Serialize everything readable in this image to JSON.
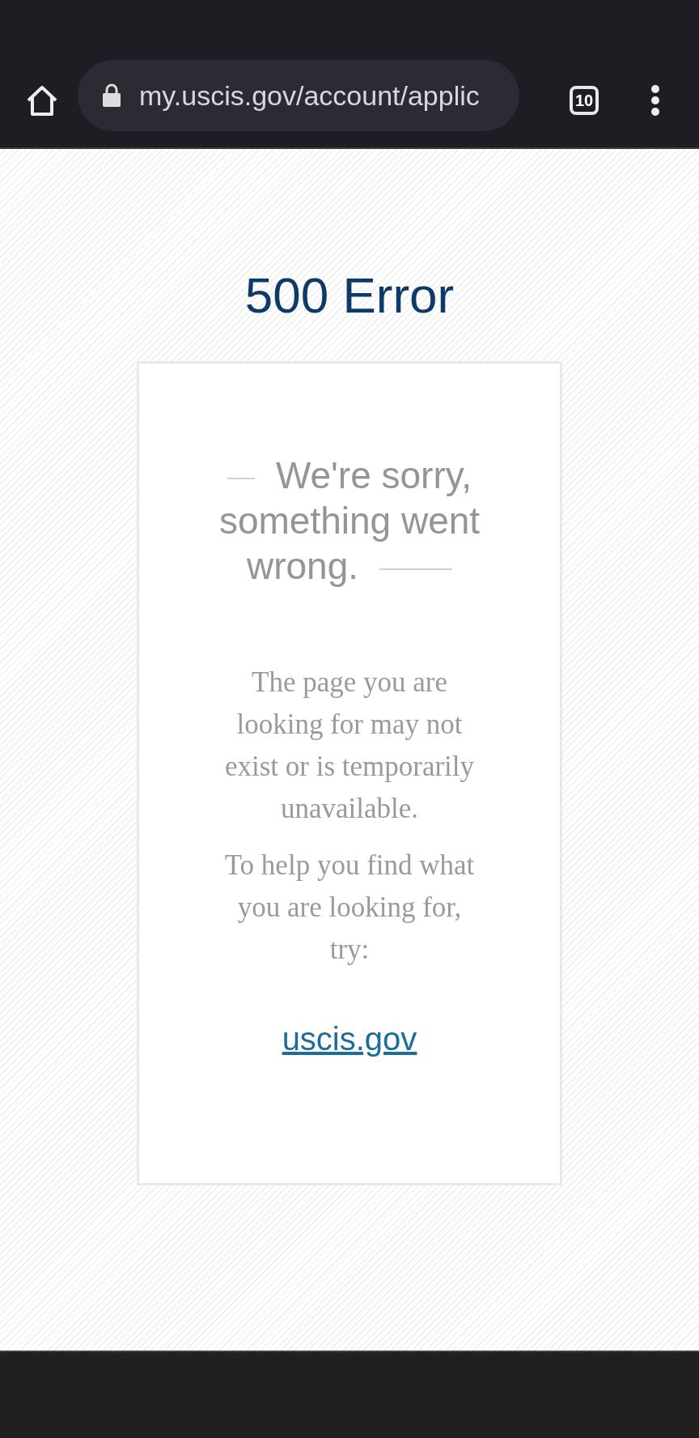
{
  "browser": {
    "url": "my.uscis.gov/account/applic",
    "tab_count": "10"
  },
  "page": {
    "title": "500 Error",
    "card": {
      "heading": "We're sorry, something went wrong.",
      "paragraphs": [
        "The page you are looking for may not exist or is temporarily unavailable.",
        "To help you find what you are looking for, try:"
      ],
      "link": "uscis.gov"
    }
  }
}
